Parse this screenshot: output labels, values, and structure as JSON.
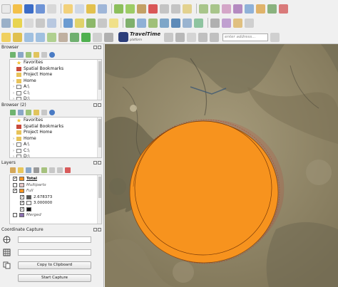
{
  "toolbar": {
    "plugin_logo_text": "TravelTime",
    "plugin_logo_sub": "platform",
    "address_placeholder": "enter address..."
  },
  "browser1": {
    "title": "Browser",
    "items": [
      {
        "label": "Favorites",
        "icon": "star-icon"
      },
      {
        "label": "Spatial Bookmarks",
        "icon": "bookmark-icon"
      },
      {
        "label": "Project Home",
        "icon": "folder-icon"
      },
      {
        "label": "Home",
        "icon": "home-folder-icon"
      },
      {
        "label": "A:\\",
        "icon": "drive-icon"
      },
      {
        "label": "C:\\",
        "icon": "drive-icon"
      },
      {
        "label": "D:\\",
        "icon": "drive-icon"
      }
    ]
  },
  "browser2": {
    "title": "Browser (2)",
    "items": [
      {
        "label": "Favorites",
        "icon": "star-icon"
      },
      {
        "label": "Spatial Bookmarks",
        "icon": "bookmark-icon"
      },
      {
        "label": "Project Home",
        "icon": "folder-icon"
      },
      {
        "label": "Home",
        "icon": "home-folder-icon"
      },
      {
        "label": "A:\\",
        "icon": "drive-icon"
      },
      {
        "label": "C:\\",
        "icon": "drive-icon"
      },
      {
        "label": "D:\\",
        "icon": "drive-icon"
      }
    ]
  },
  "layers": {
    "title": "Layers",
    "items": [
      {
        "label": "Total",
        "checked": true,
        "swatch": "#f7931e",
        "style": "bold-underline"
      },
      {
        "label": "Multiparts",
        "checked": false,
        "swatch": "#e8c8c8",
        "style": "italic"
      },
      {
        "label": "Full",
        "checked": true,
        "swatch": "#f7931e",
        "style": "italic"
      },
      {
        "label": "2.678373",
        "checked": true,
        "swatch": "#555555",
        "style": "normal"
      },
      {
        "label": "3.000000",
        "checked": true,
        "swatch": "#ffffff",
        "style": "normal"
      },
      {
        "label": "",
        "checked": true,
        "swatch": "#111111",
        "style": "normal"
      },
      {
        "label": "Merged",
        "checked": false,
        "swatch": "#8b6fb0",
        "style": "italic"
      }
    ]
  },
  "coordinate_capture": {
    "title": "Coordinate Capture",
    "copy_button": "Copy to Clipboard",
    "start_button": "Start Capture"
  },
  "map": {
    "fill_color": "#f7931e",
    "outline_color": "#c0392b"
  }
}
